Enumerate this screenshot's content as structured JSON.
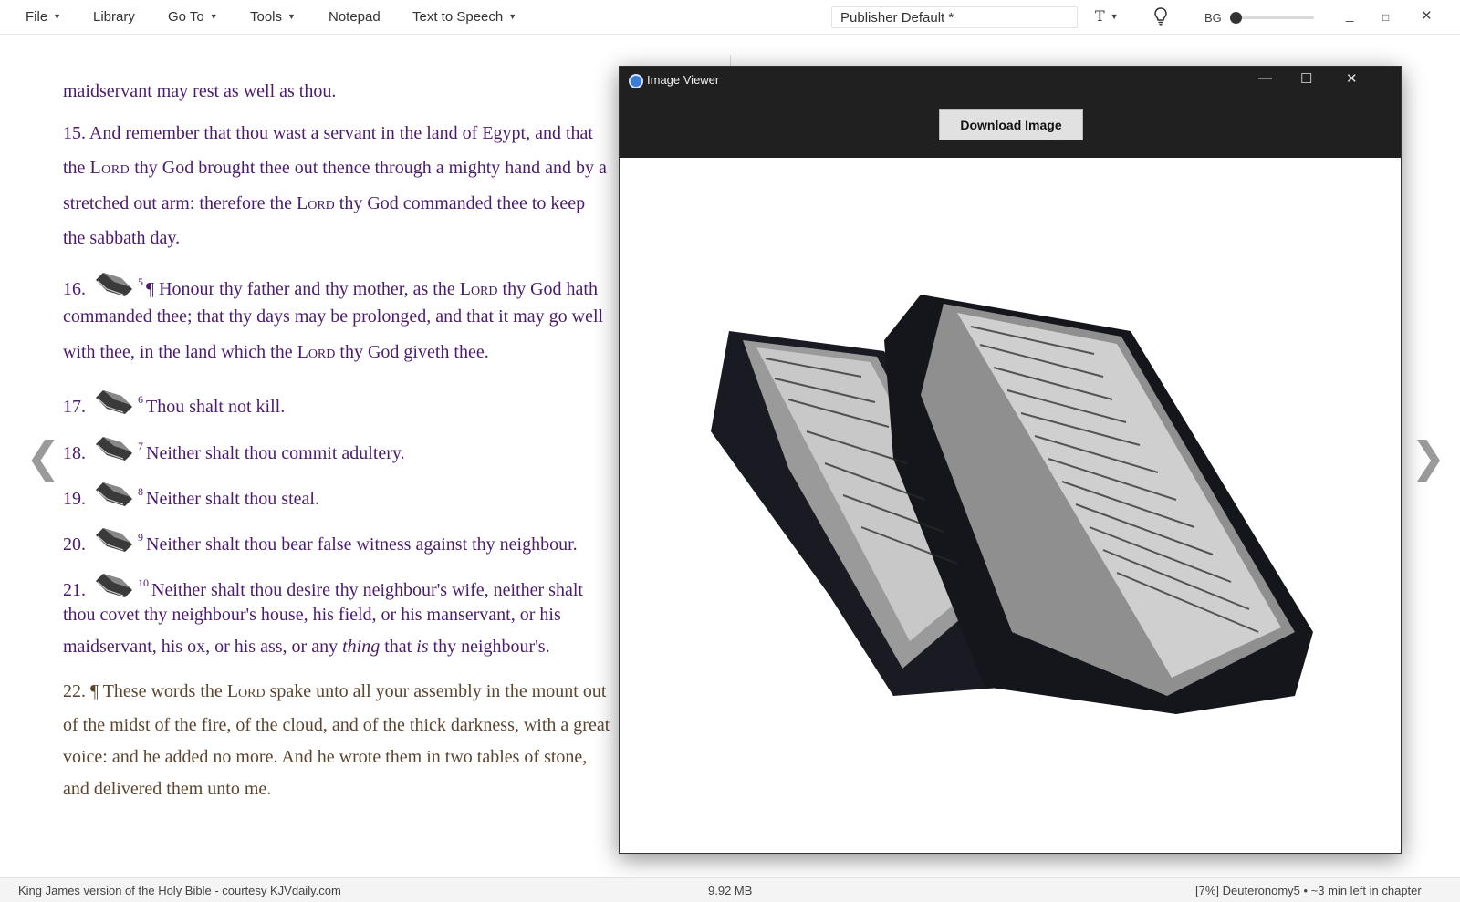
{
  "menubar": {
    "file": "File",
    "library": "Library",
    "goto": "Go To",
    "tools": "Tools",
    "notepad": "Notepad",
    "tts": "Text to Speech",
    "style_select": "Publisher Default *",
    "font_tool": "T",
    "bg_label": "BG",
    "bg_level": 0.0,
    "minimize": "_",
    "maximize": "□",
    "close": "✕"
  },
  "verses": {
    "line_intro": "maidservant may rest as well as thou.",
    "v15": {
      "num": "15.",
      "l1": "And remember that thou wast a servant in the land of Egypt, and that",
      "l2a": "the ",
      "l2_lord": "Lord",
      "l2b": " thy God brought thee out thence through a mighty hand and by a",
      "l3a": "stretched out arm: therefore the ",
      "l3_lord": "Lord",
      "l3b": " thy God commanded thee to keep",
      "l4": "the sabbath day."
    },
    "v16": {
      "num": "16.",
      "sup": "5",
      "l1a": "¶ Honour thy father and thy mother, as the ",
      "l1_lord": "Lord",
      "l1b": " thy God hath",
      "l2": "commanded thee; that thy days may be prolonged, and that it may go well",
      "l3a": "with thee, in the land which the ",
      "l3_lord": "Lord",
      "l3b": " thy God giveth thee."
    },
    "v17": {
      "num": "17.",
      "sup": "6",
      "text": "Thou shalt not kill."
    },
    "v18": {
      "num": "18.",
      "sup": "7",
      "text": "Neither shalt thou commit adultery."
    },
    "v19": {
      "num": "19.",
      "sup": "8",
      "text": "Neither shalt thou steal."
    },
    "v20": {
      "num": "20.",
      "sup": "9",
      "text": "Neither shalt thou bear false witness against thy neighbour."
    },
    "v21": {
      "num": "21.",
      "sup": "10",
      "l1": "Neither shalt thou desire thy neighbour's wife, neither shalt",
      "l2": "thou covet thy neighbour's house, his field, or his manservant, or his",
      "l3a": "maidservant, his ox, or his ass, or any ",
      "l3_thing": "thing",
      "l3b": " that ",
      "l3_is": "is",
      "l3c": " thy neighbour's."
    },
    "v22": {
      "num": "22.",
      "l1a": "¶ These words the ",
      "l1_lord": "Lord",
      "l1b": " spake unto all your assembly in the mount out",
      "l2": "of the midst of the fire, of the cloud, and of the thick darkness, with a great",
      "l3": "voice: and he added no more. And he wrote them in two tables of stone,",
      "l4": "and delivered them unto me."
    }
  },
  "nav": {
    "prev": "❮",
    "next": "❯"
  },
  "viewer": {
    "title": "Image Viewer",
    "minimize": "—",
    "maximize": "☐",
    "close": "✕",
    "download_label": "Download Image",
    "image_icon": "stone-tablets-image"
  },
  "status": {
    "left": "King James version of the Holy Bible - courtesy KJVdaily.com",
    "center": "9.92 MB",
    "right": "[7%] Deuteronomy5 • ~3 min left in chapter"
  }
}
